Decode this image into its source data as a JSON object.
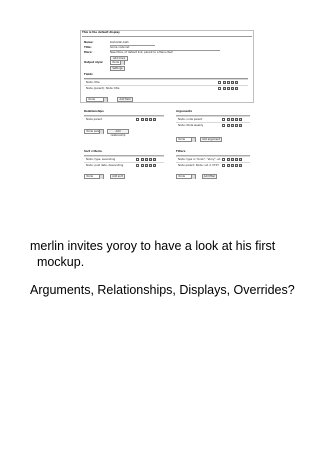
{
  "mockup": {
    "title": "This is the default display",
    "form": {
      "name_label": "Name:",
      "name_value": "blah-blah-blah",
      "title_label": "Title:",
      "title_value": "Some node list",
      "more_label": "More:",
      "more_value": "New More, of default link, parent to a Menu Item",
      "more_button": "Add more",
      "output_label": "Output style:",
      "output_value": "Node",
      "output_button": "Settings"
    },
    "fields": {
      "title": "Fields",
      "rows": [
        "Node: title",
        "Node (parent): Node: title"
      ],
      "select_value": "Node",
      "add_button": "Add field"
    },
    "relationships": {
      "title": "Relationships",
      "rows": [
        "Node parent"
      ],
      "select_value": "Node parent",
      "add_button": "Add relationship"
    },
    "arguments": {
      "title": "Arguments",
      "rows": [
        "Node: node parent",
        "Node: Node weekly"
      ],
      "select_value": "Node",
      "add_button": "Add argument"
    },
    "sort": {
      "title": "Sort criteria",
      "rows": [
        "Node: type, ascending",
        "Node: post date, descending"
      ],
      "select_value": "Node",
      "add_button": "Add sort"
    },
    "filters": {
      "title": "Filters",
      "rows": [
        "Node: type in \"book\", \"story\", et..",
        "Node parent: Node: nid ≠ CTXT"
      ],
      "select_value": "Node",
      "add_button": "Add filter"
    }
  },
  "caption": {
    "line1": "merlin invites  yoroy to have a look at his first",
    "line2": "  mockup.",
    "line3": "Arguments, Relationships, Displays, Overrides?"
  }
}
